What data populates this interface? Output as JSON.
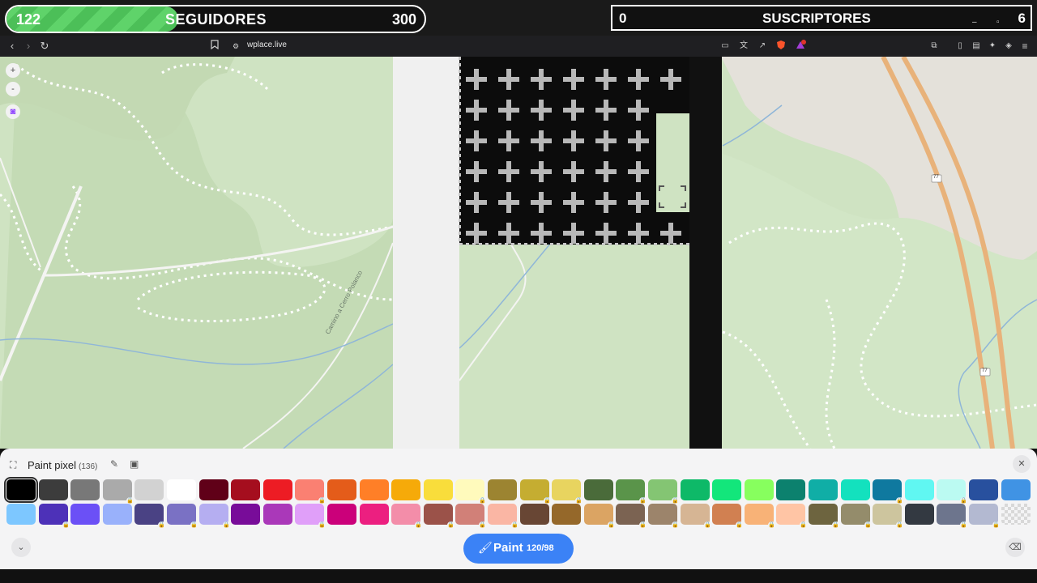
{
  "overlay": {
    "followers": {
      "count": "122",
      "label": "SEGUIDORES",
      "goal": "300",
      "progress": 0.41,
      "fill_color": "#5fd36a"
    },
    "subscribers": {
      "count": "0",
      "label": "SUSCRIPTORES",
      "goal": "6"
    }
  },
  "browser": {
    "url": "wplace.live",
    "nav_icons": [
      "back-icon",
      "forward-icon",
      "reload-icon",
      "bookmark-icon"
    ],
    "ext_badge": "1"
  },
  "map": {
    "controls": [
      "+",
      "-"
    ],
    "road_badges": [
      "77",
      "77"
    ],
    "trail_label": "Camino a Cerro Polanco"
  },
  "panel": {
    "title": "Paint pixel",
    "count": "(136)",
    "paint_button": {
      "label": "Paint",
      "charges": "120/98"
    },
    "row1": [
      {
        "c": "#000000",
        "sel": true
      },
      {
        "c": "#3c3c3c"
      },
      {
        "c": "#787878"
      },
      {
        "c": "#aaaaaa",
        "lock": true
      },
      {
        "c": "#d2d2d2"
      },
      {
        "c": "#ffffff"
      },
      {
        "c": "#600018"
      },
      {
        "c": "#a50e1e"
      },
      {
        "c": "#ed1c24"
      },
      {
        "c": "#fa8072",
        "lock": true
      },
      {
        "c": "#e45c1a"
      },
      {
        "c": "#ff7f27"
      },
      {
        "c": "#f6aa09"
      },
      {
        "c": "#f9dd3b"
      },
      {
        "c": "#fffabc",
        "lock": true
      },
      {
        "c": "#9c8431"
      },
      {
        "c": "#c5ad31",
        "lock": true
      },
      {
        "c": "#e8d45f",
        "lock": true
      },
      {
        "c": "#4a6b3a"
      },
      {
        "c": "#5a944a",
        "lock": true
      },
      {
        "c": "#84c573",
        "lock": true
      },
      {
        "c": "#0eb968"
      },
      {
        "c": "#13e67b"
      },
      {
        "c": "#87ff5e"
      },
      {
        "c": "#0c816e"
      },
      {
        "c": "#10aea6"
      },
      {
        "c": "#13e1be"
      },
      {
        "c": "#0f799f",
        "lock": true
      },
      {
        "c": "#60f7f2"
      },
      {
        "c": "#bbfaf2",
        "lock": true
      },
      {
        "c": "#28509e"
      },
      {
        "c": "#4093e4"
      }
    ],
    "row2": [
      {
        "c": "#7dc7ff"
      },
      {
        "c": "#4d31b8",
        "lock": true
      },
      {
        "c": "#6b50f6"
      },
      {
        "c": "#99b1fb"
      },
      {
        "c": "#4a4284",
        "lock": true
      },
      {
        "c": "#7a71c4",
        "lock": true
      },
      {
        "c": "#b5aef1",
        "lock": true
      },
      {
        "c": "#780c99"
      },
      {
        "c": "#aa38b9"
      },
      {
        "c": "#e09ff9",
        "lock": true
      },
      {
        "c": "#cb007a"
      },
      {
        "c": "#ec1f80"
      },
      {
        "c": "#f38da9",
        "lock": true
      },
      {
        "c": "#9b5249",
        "lock": true
      },
      {
        "c": "#d18078",
        "lock": true
      },
      {
        "c": "#fab6a4",
        "lock": true
      },
      {
        "c": "#684634"
      },
      {
        "c": "#95682a"
      },
      {
        "c": "#dba463",
        "lock": true
      },
      {
        "c": "#7b6352",
        "lock": true
      },
      {
        "c": "#9c846b",
        "lock": true
      },
      {
        "c": "#d6b594",
        "lock": true
      },
      {
        "c": "#d18051",
        "lock": true
      },
      {
        "c": "#f8b277",
        "lock": true
      },
      {
        "c": "#ffc5a5",
        "lock": true
      },
      {
        "c": "#6d643f",
        "lock": true
      },
      {
        "c": "#948c6b",
        "lock": true
      },
      {
        "c": "#cdc59e",
        "lock": true
      },
      {
        "c": "#333941"
      },
      {
        "c": "#6d758d",
        "lock": true
      },
      {
        "c": "#b3b9d1",
        "lock": true
      },
      {
        "c": "transparent"
      }
    ]
  }
}
